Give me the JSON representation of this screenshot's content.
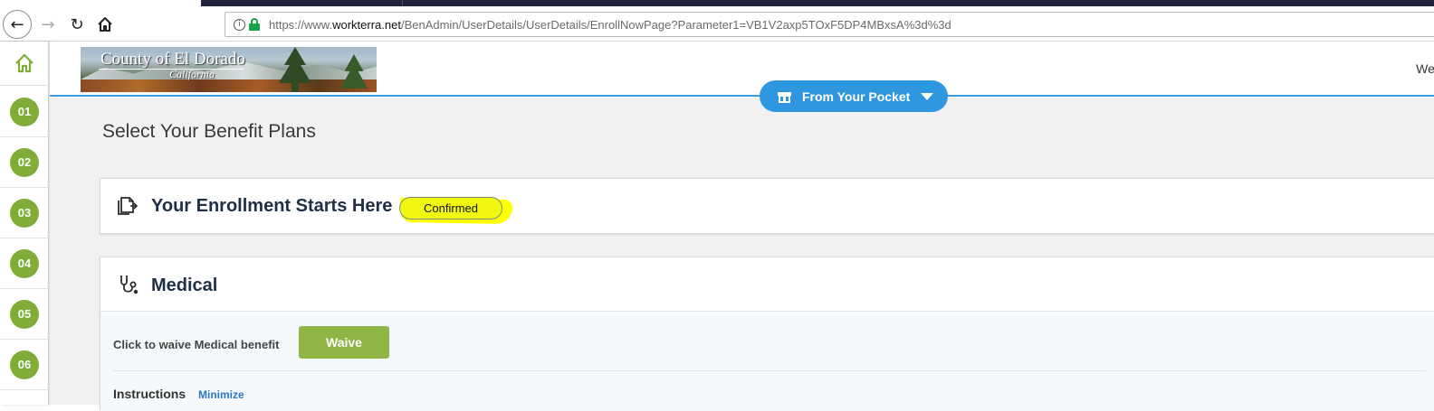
{
  "browser": {
    "url_prefix": "https://www.",
    "url_domain": "workterra.net",
    "url_path": "/BenAdmin/UserDetails/UserDetails/EnrollNowPage?Parameter1=VB1V2axp5TOxF5DP4MBxsA%3d%3d",
    "back_glyph": "←",
    "forward_glyph": "→",
    "reload_glyph": "↻",
    "home_glyph": "⌂",
    "info_glyph": "i"
  },
  "rail": {
    "steps": [
      "01",
      "02",
      "03",
      "04",
      "05",
      "06"
    ]
  },
  "header": {
    "logo_county": "County of El Dorado",
    "logo_state": "California",
    "welcome": "Wel",
    "pocket_label": "From Your Pocket"
  },
  "page": {
    "title": "Select Your Benefit Plans"
  },
  "enrollment": {
    "title": "Your Enrollment Starts Here",
    "status": "Confirmed"
  },
  "medical": {
    "title": "Medical",
    "waive_text": "Click to waive Medical benefit",
    "waive_button": "Waive",
    "instructions_label": "Instructions",
    "minimize_link": "Minimize"
  },
  "colors": {
    "accent_green": "#7fad36",
    "accent_blue": "#2f97e0",
    "highlight": "#ffff00"
  },
  "icons": [
    "back-icon",
    "forward-icon",
    "reload-icon",
    "home-icon",
    "info-icon",
    "lock-icon",
    "gift-icon",
    "caret-down-icon",
    "document-icon",
    "stethoscope-icon"
  ]
}
